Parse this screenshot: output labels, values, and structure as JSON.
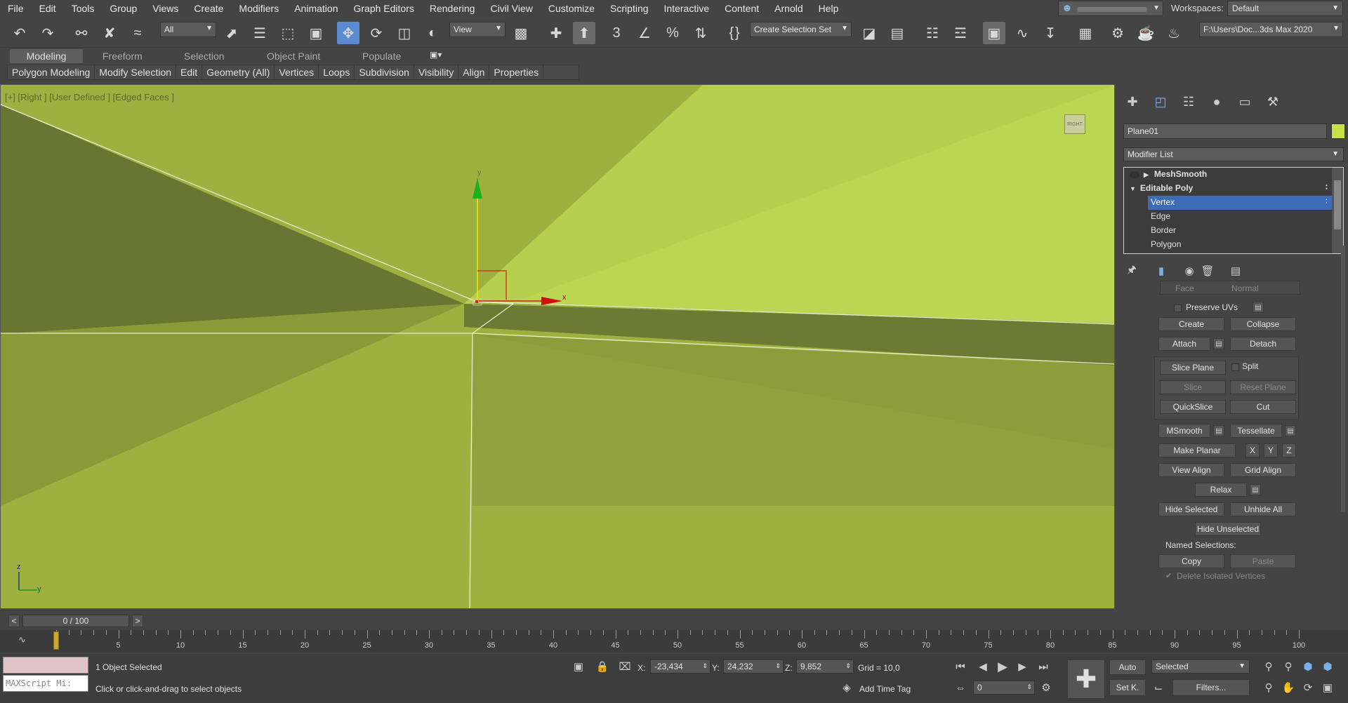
{
  "menu": [
    "File",
    "Edit",
    "Tools",
    "Group",
    "Views",
    "Create",
    "Modifiers",
    "Animation",
    "Graph Editors",
    "Rendering",
    "Civil View",
    "Customize",
    "Scripting",
    "Interactive",
    "Content",
    "Arnold",
    "Help"
  ],
  "workspaces": {
    "label": "Workspaces:",
    "value": "Default"
  },
  "toolbar": {
    "filter_value": "All",
    "refcoord_value": "View",
    "snap_3d": "3",
    "named_selection": "Create Selection Set",
    "project_path": "F:\\Users\\Doc...3ds Max 2020"
  },
  "ribbon": {
    "tabs": [
      "Modeling",
      "Freeform",
      "Selection",
      "Object Paint",
      "Populate"
    ],
    "panel": [
      "Polygon Modeling",
      "Modify Selection",
      "Edit",
      "Geometry (All)",
      "Vertices",
      "Loops",
      "Subdivision",
      "Visibility",
      "Align",
      "Properties"
    ]
  },
  "viewport": {
    "label": "[+] [Right ] [User Defined ] [Edged Faces ]",
    "viewcube": "RIGHT",
    "gizmo_x": "x",
    "gizmo_y": "y",
    "axis_z": "z",
    "axis_y": "y"
  },
  "command_panel": {
    "object_name": "Plane01",
    "object_color": "#c8e04a",
    "modifier_list": "Modifier List",
    "stack": [
      {
        "label": "MeshSmooth",
        "type": "modifier"
      },
      {
        "label": "Editable Poly",
        "type": "base"
      },
      {
        "label": "Vertex",
        "type": "sub",
        "selected": true
      },
      {
        "label": "Edge",
        "type": "sub"
      },
      {
        "label": "Border",
        "type": "sub"
      },
      {
        "label": "Polygon",
        "type": "sub"
      }
    ],
    "rollout": {
      "face": "Face",
      "normal": "Normal",
      "preserve_uvs": "Preserve UVs",
      "create": "Create",
      "collapse": "Collapse",
      "attach": "Attach",
      "detach": "Detach",
      "slice_plane": "Slice Plane",
      "split": "Split",
      "slice": "Slice",
      "reset_plane": "Reset Plane",
      "quickslice": "QuickSlice",
      "cut": "Cut",
      "msmooth": "MSmooth",
      "tessellate": "Tessellate",
      "make_planar": "Make Planar",
      "x": "X",
      "y": "Y",
      "z": "Z",
      "view_align": "View Align",
      "grid_align": "Grid Align",
      "relax": "Relax",
      "hide_selected": "Hide Selected",
      "unhide_all": "Unhide All",
      "hide_unselected": "Hide Unselected",
      "named_selections": "Named Selections:",
      "copy": "Copy",
      "paste": "Paste",
      "delete_isolated": "Delete Isolated Vertices"
    }
  },
  "timeline": {
    "frame_display": "0 / 100",
    "prev": "<",
    "next": ">",
    "tick_labels": [
      "0",
      "5",
      "10",
      "15",
      "20",
      "25",
      "30",
      "35",
      "40",
      "45",
      "50",
      "55",
      "60",
      "65",
      "70",
      "75",
      "80",
      "85",
      "90",
      "95",
      "100"
    ]
  },
  "status": {
    "maxscript": "MAXScript Mi:",
    "selected_count": "1 Object Selected",
    "prompt": "Click or click-and-drag to select objects",
    "x_label": "X:",
    "x_value": "-23,434",
    "y_label": "Y:",
    "y_value": "24,232",
    "z_label": "Z:",
    "z_value": "9,852",
    "grid": "Grid = 10,0",
    "add_time_tag": "Add Time Tag",
    "current_frame": "0",
    "auto": "Auto",
    "set_key": "Set K.",
    "key_mode": "Selected",
    "filters": "Filters..."
  }
}
